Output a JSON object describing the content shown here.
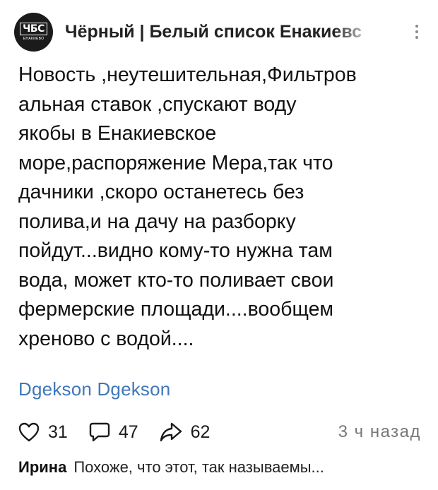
{
  "channel": {
    "avatar_text": "ЧБС",
    "avatar_subtext": "ЕНАКИЕВО",
    "name": "Чёрный | Белый список Енакиевс"
  },
  "post": {
    "text": "Новость ,неутешительная,Фильтров\nальная ставок ,спускают воду\nякобы в Енакиевское\nморе,распоряжение Мера,так что\nдачники ,скоро останетесь без\nполива,и на дачу на разборку\nпойдут...видно кому-то нужна там\nвода, может кто-то поливает свои\nфермерские площади....вообщем\nхреново с водой....",
    "author": "Dgekson Dgekson"
  },
  "actions": {
    "likes": "31",
    "comments": "47",
    "shares": "62",
    "timestamp": "3 ч назад"
  },
  "comment": {
    "author": "Ирина",
    "text": "Похоже, что этот, так называемы..."
  },
  "icons": {
    "like": "heart-icon",
    "comment": "comment-bubble-icon",
    "share": "share-arrow-icon",
    "more": "more-vertical-icon"
  },
  "colors": {
    "link": "#3f78b8",
    "timestamp": "#777777",
    "avatar_bg": "#1b1b1b"
  }
}
